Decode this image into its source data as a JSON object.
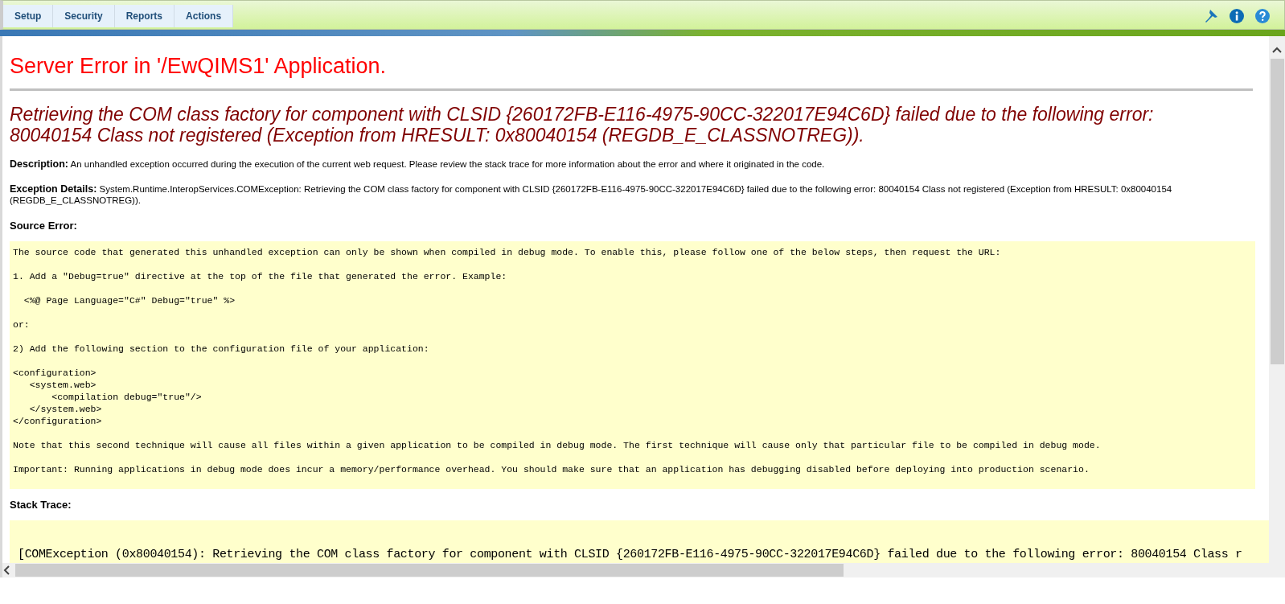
{
  "nav": {
    "tabs": [
      {
        "label": "Setup",
        "selected": false
      },
      {
        "label": "Security",
        "selected": false
      },
      {
        "label": "Reports",
        "selected": false
      },
      {
        "label": "Actions",
        "selected": false
      }
    ]
  },
  "page": {
    "title": "Server Error in '/EwQIMS1' Application.",
    "error_message": "Retrieving the COM class factory for component with CLSID {260172FB-E116-4975-90CC-322017E94C6D} failed due to the following error: 80040154 Class not registered (Exception from HRESULT: 0x80040154 (REGDB_E_CLASSNOTREG)).",
    "description": {
      "label": "Description:",
      "text": "An unhandled exception occurred during the execution of the current web request. Please review the stack trace for more information about the error and where it originated in the code."
    },
    "exception_details": {
      "label": "Exception Details:",
      "text": "System.Runtime.InteropServices.COMException: Retrieving the COM class factory for component with CLSID {260172FB-E116-4975-90CC-322017E94C6D} failed due to the following error: 80040154 Class not registered (Exception from HRESULT: 0x80040154 (REGDB_E_CLASSNOTREG))."
    },
    "source_error": {
      "heading": "Source Error:",
      "blocks": [
        [
          "The source code that generated this unhandled exception can only be shown when compiled in debug mode. To enable this, please follow one of the below steps, then request the URL:"
        ],
        [
          "1. Add a \"Debug=true\" directive at the top of the file that generated the error. Example:"
        ],
        [
          "  <%@ Page Language=\"C#\" Debug=\"true\" %>"
        ],
        [
          "or:"
        ],
        [
          "2) Add the following section to the configuration file of your application:"
        ],
        [
          "<configuration>",
          "   <system.web>",
          "       <compilation debug=\"true\"/>",
          "   </system.web>",
          "</configuration>"
        ],
        [
          "Note that this second technique will cause all files within a given application to be compiled in debug mode. The first technique will cause only that particular file to be compiled in debug mode."
        ],
        [
          "Important: Running applications in debug mode does incur a memory/performance overhead. You should make sure that an application has debugging disabled before deploying into production scenario."
        ]
      ]
    },
    "stack_trace": {
      "heading": "Stack Trace:",
      "lines": [
        "[COMException (0x80040154): Retrieving the COM class factory for component with CLSID {260172FB-E116-4975-90CC-322017E94C6D} failed due to the following error: 80040154 Class r"
      ]
    }
  }
}
